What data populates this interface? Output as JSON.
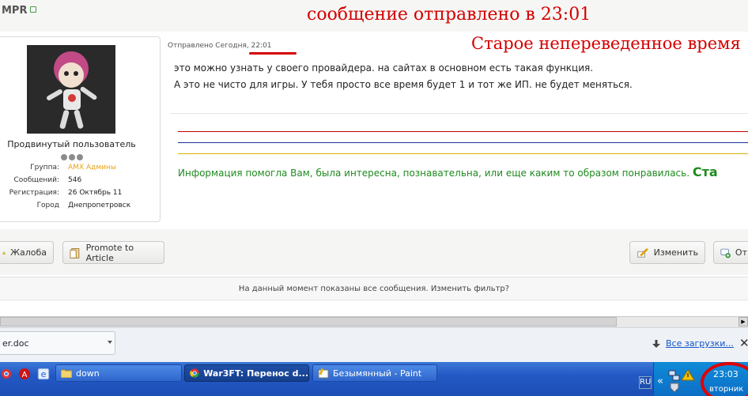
{
  "post": {
    "author": "MPR",
    "posted_label": "Отправлено Сегодня, ",
    "posted_time": "22:01",
    "line1": "это можно узнать у своего провайдера. на сайтах в основном есть такая функция.",
    "line2": "А это не чисто для игры. У тебя просто все время будет 1 и тот же ИП. не будет меняться."
  },
  "annotations": {
    "sent_note": "сообщение отправлено в 23:01",
    "old_time_note": "Старое непереведенное время"
  },
  "profile": {
    "rank": "Продвинутый пользователь",
    "fields": [
      {
        "key": "Группа:",
        "value": "AMX Админы"
      },
      {
        "key": "Сообщений:",
        "value": "546"
      },
      {
        "key": "Регистрация:",
        "value": "26 Октябрь 11"
      },
      {
        "key": "Город",
        "value": "Днепропетровск"
      }
    ],
    "group_color": "#e8a317"
  },
  "signature": {
    "text": "Информация помогла Вам, была интересна, познавательна, или еще каким то образом понравилась.",
    "big": "Ста",
    "line_colors": [
      "#c00000",
      "#1a2f9a",
      "#d8b300"
    ]
  },
  "buttons": {
    "report": "Жалоба",
    "promote": "Promote to Article",
    "edit": "Изменить",
    "reply": "От"
  },
  "notice": "На данный момент показаны все сообщения. Изменить фильтр?",
  "downloads": {
    "item": "er.doc",
    "show_all": "Все загрузки...",
    "close": "✕"
  },
  "taskbar": {
    "items": [
      {
        "label": "down",
        "icon": "folder-icon"
      },
      {
        "label": "War3FT: Перенос d...",
        "icon": "chrome-icon",
        "active": true
      },
      {
        "label": "Безымянный - Paint",
        "icon": "paint-icon"
      }
    ],
    "lang": "RU",
    "chevron": "«",
    "time": "23:03",
    "day": "вторник"
  }
}
